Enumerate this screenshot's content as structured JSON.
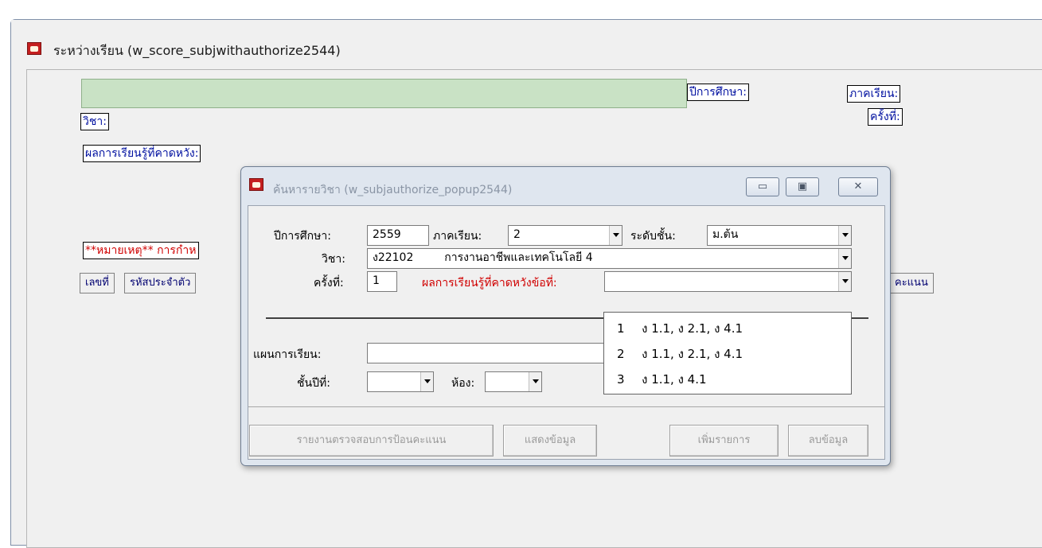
{
  "main_window": {
    "title": "ระหว่างเรียน (w_score_subjwithauthorize2544)",
    "labels": {
      "academic_year": "ปีการศึกษา:",
      "semester": "ภาคเรียน:",
      "subject": "วิชา:",
      "round": "ครั้งที่:",
      "expected_outcome": "ผลการเรียนรู้ที่คาดหวัง:",
      "note": "**หมายเหตุ** การกำห"
    },
    "columns": {
      "number": "เลขที่",
      "student_id": "รหัสประจำตัว",
      "score": "คะแนน"
    }
  },
  "popup": {
    "title": "ค้นหารายวิชา (w_subjauthorize_popup2544)",
    "fields": {
      "academic_year_label": "ปีการศึกษา:",
      "academic_year_value": "2559",
      "semester_label": "ภาคเรียน:",
      "semester_value": "2",
      "level_label": "ระดับชั้น:",
      "level_value": "ม.ต้น",
      "subject_label": "วิชา:",
      "subject_code": "ง22102",
      "subject_name": "การงานอาชีพและเทคโนโลยี 4",
      "round_label": "ครั้งที่:",
      "round_value": "1",
      "outcome_label": "ผลการเรียนรู้ที่คาดหวังข้อที่:",
      "outcome_value": "",
      "plan_label": "แผนการเรียน:",
      "plan_value": "",
      "grade_label": "ชั้นปีที่:",
      "grade_value": "",
      "room_label": "ห้อง:",
      "room_value": ""
    },
    "buttons": {
      "report": "รายงานตรวจสอบการป้อนคะแนน",
      "show": "แสดงข้อมูล",
      "add": "เพิ่มรายการ",
      "delete": "ลบข้อมูล"
    },
    "dropdown_items": [
      {
        "num": "1",
        "text": "ง 1.1, ง 2.1, ง 4.1"
      },
      {
        "num": "2",
        "text": "ง 1.1, ง 2.1, ง 4.1"
      },
      {
        "num": "3",
        "text": "ง 1.1, ง 4.1"
      }
    ]
  }
}
